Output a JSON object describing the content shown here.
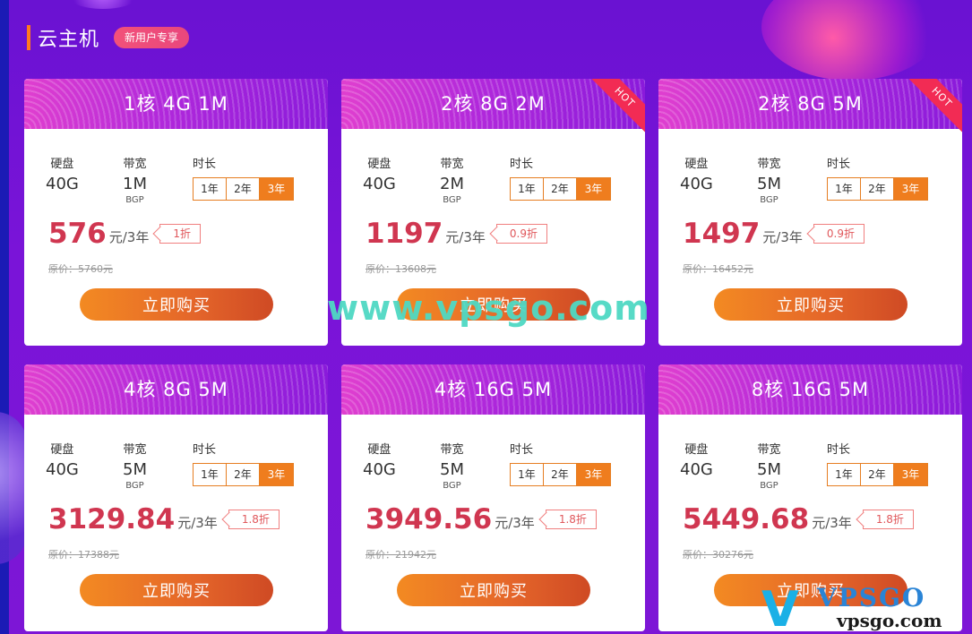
{
  "section": {
    "title": "云主机",
    "badge": "新用户专享"
  },
  "labels": {
    "disk": "硬盘",
    "bandwidth": "带宽",
    "duration": "时长",
    "bgp": "BGP",
    "buy": "立即购买",
    "hot": "HOT"
  },
  "cards": [
    {
      "title": "1核  4G  1M",
      "disk": "40G",
      "bandwidth": "1M",
      "durations": [
        "1年",
        "2年",
        "3年"
      ],
      "selected": "3年",
      "price": "576",
      "unit": "元/3年",
      "discount": "1折",
      "original": "原价：5760元",
      "hot": false
    },
    {
      "title": "2核  8G  2M",
      "disk": "40G",
      "bandwidth": "2M",
      "durations": [
        "1年",
        "2年",
        "3年"
      ],
      "selected": "3年",
      "price": "1197",
      "unit": "元/3年",
      "discount": "0.9折",
      "original": "原价：13608元",
      "hot": true
    },
    {
      "title": "2核  8G  5M",
      "disk": "40G",
      "bandwidth": "5M",
      "durations": [
        "1年",
        "2年",
        "3年"
      ],
      "selected": "3年",
      "price": "1497",
      "unit": "元/3年",
      "discount": "0.9折",
      "original": "原价：16452元",
      "hot": true
    },
    {
      "title": "4核  8G  5M",
      "disk": "40G",
      "bandwidth": "5M",
      "durations": [
        "1年",
        "2年",
        "3年"
      ],
      "selected": "3年",
      "price": "3129.84",
      "unit": "元/3年",
      "discount": "1.8折",
      "original": "原价：17388元",
      "hot": false
    },
    {
      "title": "4核  16G  5M",
      "disk": "40G",
      "bandwidth": "5M",
      "durations": [
        "1年",
        "2年",
        "3年"
      ],
      "selected": "3年",
      "price": "3949.56",
      "unit": "元/3年",
      "discount": "1.8折",
      "original": "原价：21942元",
      "hot": false
    },
    {
      "title": "8核  16G  5M",
      "disk": "40G",
      "bandwidth": "5M",
      "durations": [
        "1年",
        "2年",
        "3年"
      ],
      "selected": "3年",
      "price": "5449.68",
      "unit": "元/3年",
      "discount": "1.8折",
      "original": "原价：30276元",
      "hot": false
    }
  ],
  "watermark": {
    "text": "www.vpsgo.com",
    "logo_mark": "V",
    "logo_top": "VPSGO",
    "logo_bottom": "vpsgo.com"
  },
  "colors": {
    "accent": "#ef7d1e",
    "price": "#d03650",
    "background": "#7a14d8"
  }
}
